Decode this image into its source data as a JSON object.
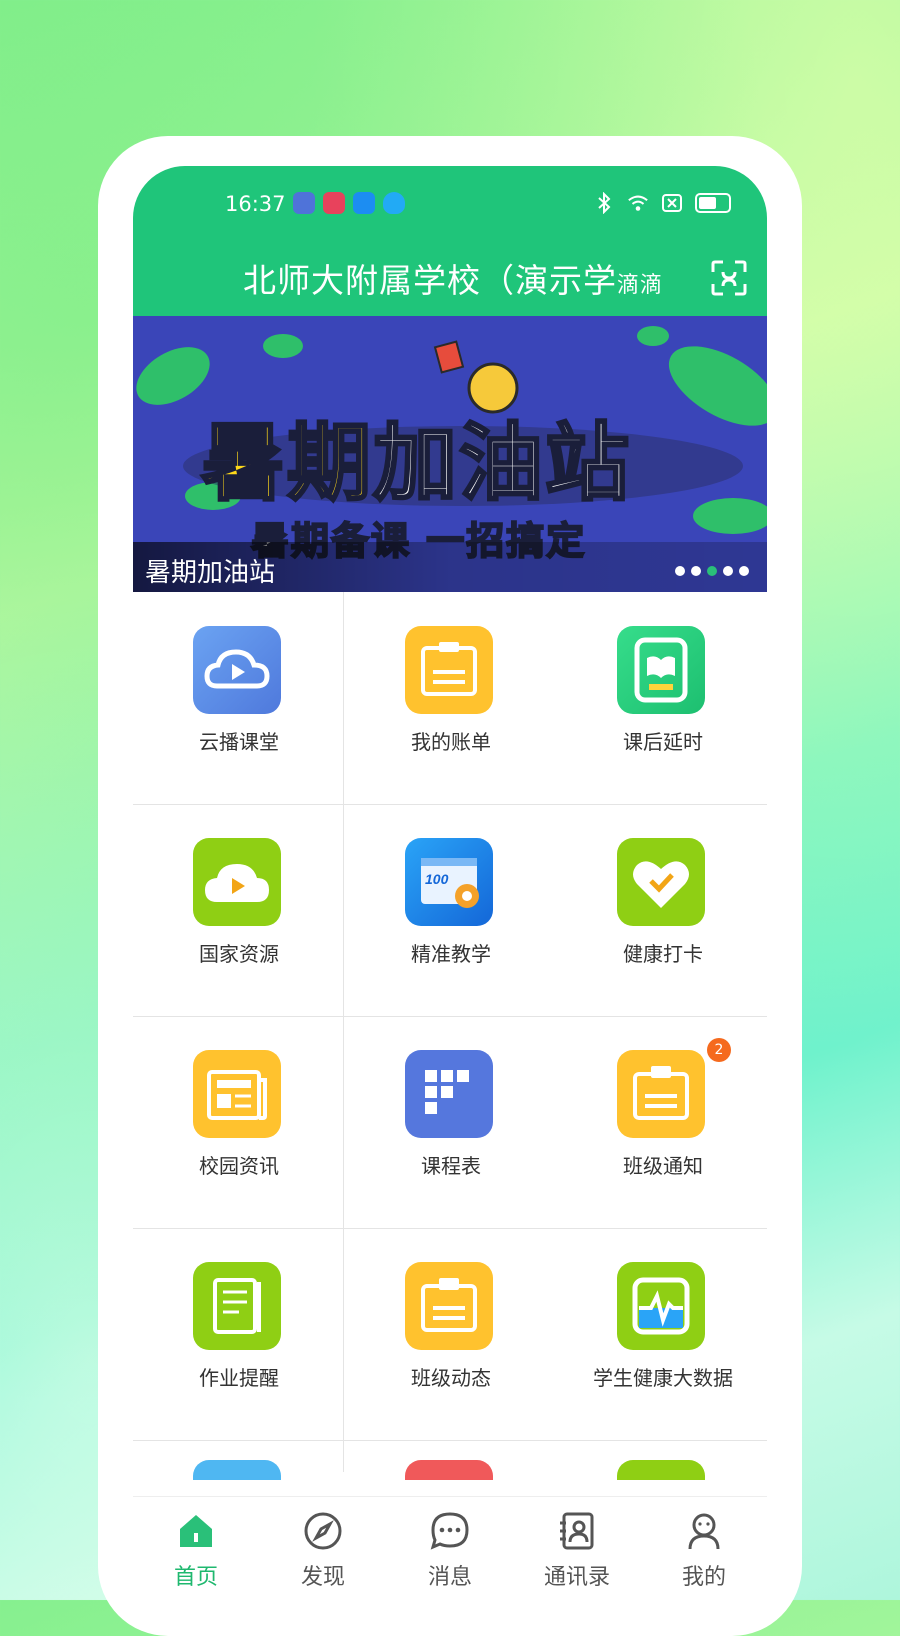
{
  "status_bar": {
    "time": "16:37"
  },
  "header": {
    "title": "北师大附属学校（演示学",
    "title_suffix": "滴滴",
    "scan_icon": "scan-icon"
  },
  "banner": {
    "headline_yellow": "暑期",
    "headline_white": "加油站",
    "subtitle": "暑期备课 一招搞定",
    "caption": "暑期加油站",
    "slide_count": 5,
    "active_slide": 3
  },
  "colors": {
    "primary": "#1fc57a",
    "badge": "#f56a1e"
  },
  "grid": [
    {
      "label": "云播课堂",
      "icon": "cloud-play-icon",
      "color": "#5b8ee6"
    },
    {
      "label": "我的账单",
      "icon": "bill-icon",
      "color": "#ffc22e"
    },
    {
      "label": "课后延时",
      "icon": "book-icon",
      "color": "#26d07e"
    },
    {
      "label": "国家资源",
      "icon": "cloud-resource-icon",
      "color": "#8fcf14"
    },
    {
      "label": "精准教学",
      "icon": "precision-teaching-icon",
      "color": "#1d86f0"
    },
    {
      "label": "健康打卡",
      "icon": "heart-check-icon",
      "color": "#8fcf14"
    },
    {
      "label": "校园资讯",
      "icon": "news-icon",
      "color": "#ffc22e"
    },
    {
      "label": "课程表",
      "icon": "schedule-icon",
      "color": "#5577dd"
    },
    {
      "label": "班级通知",
      "icon": "notice-icon",
      "color": "#ffc22e",
      "badge": "2"
    },
    {
      "label": "作业提醒",
      "icon": "homework-icon",
      "color": "#8fcf14"
    },
    {
      "label": "班级动态",
      "icon": "class-feed-icon",
      "color": "#ffc22e"
    },
    {
      "label": "学生健康大数据",
      "icon": "health-data-icon",
      "color": "#8fcf14"
    }
  ],
  "tabbar": [
    {
      "label": "首页",
      "icon": "home-icon",
      "active": true
    },
    {
      "label": "发现",
      "icon": "compass-icon",
      "active": false
    },
    {
      "label": "消息",
      "icon": "message-icon",
      "active": false
    },
    {
      "label": "通讯录",
      "icon": "contacts-icon",
      "active": false
    },
    {
      "label": "我的",
      "icon": "profile-icon",
      "active": false
    }
  ]
}
